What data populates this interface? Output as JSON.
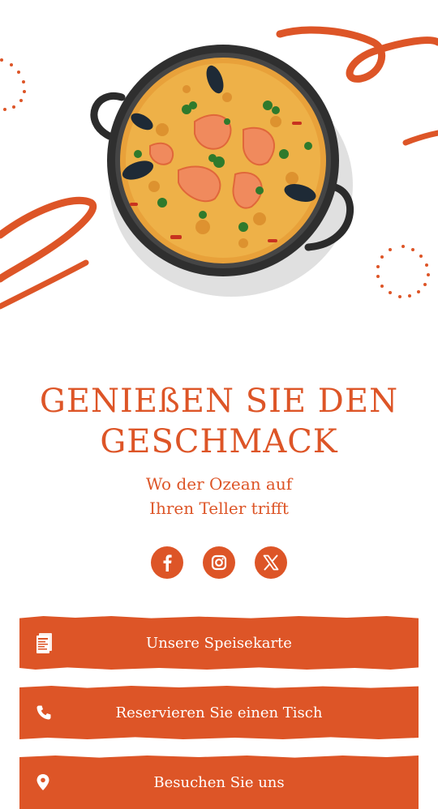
{
  "hero": {
    "title_line1": "GENIEßEN SIE DEN",
    "title_line2": "GESCHMACK",
    "subtitle_line1": "Wo der Ozean auf",
    "subtitle_line2": "Ihren Teller trifft"
  },
  "socials": [
    {
      "name": "facebook-icon"
    },
    {
      "name": "instagram-icon"
    },
    {
      "name": "x-twitter-icon"
    }
  ],
  "buttons": {
    "menu": "Unsere Speisekarte",
    "reserve": "Reservieren Sie einen Tisch",
    "contact": "Besuchen Sie uns"
  },
  "colors": {
    "accent": "#dd5527",
    "background": "#ffffff"
  }
}
